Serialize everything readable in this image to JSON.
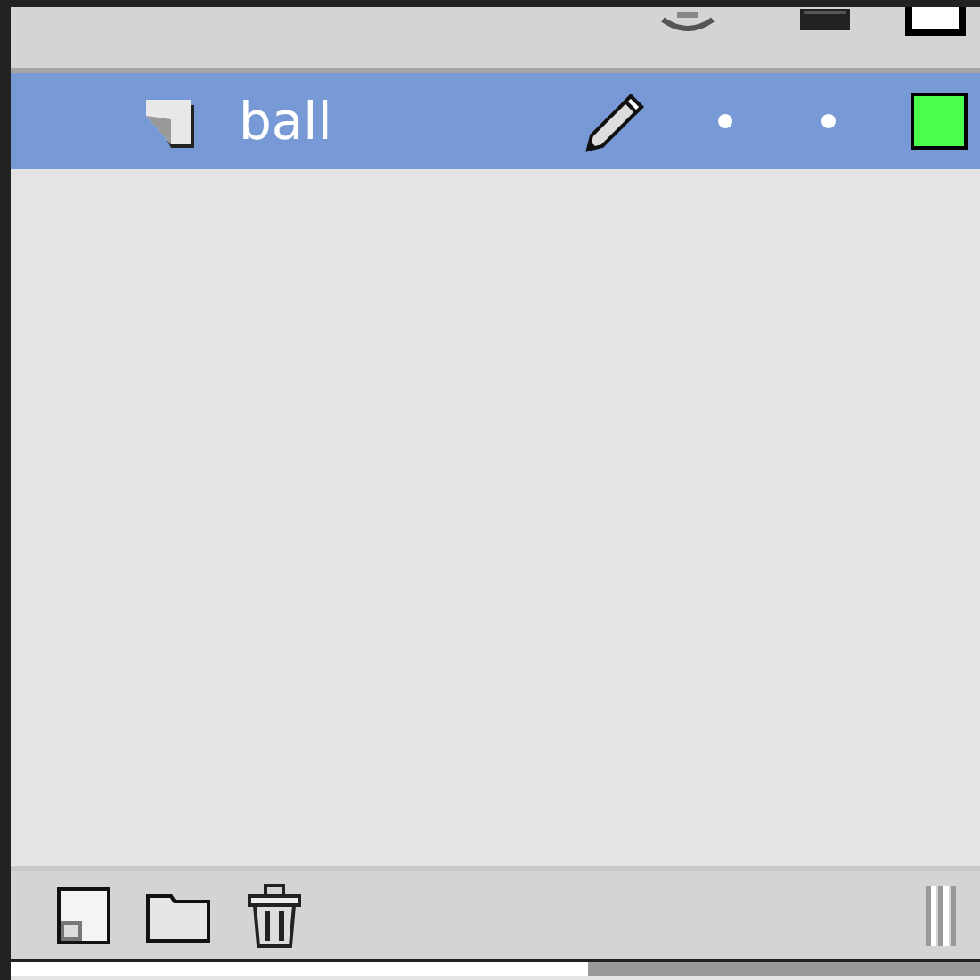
{
  "layers": [
    {
      "name": "ball",
      "selected": true,
      "editing": true,
      "hidden": false,
      "locked": false,
      "color": "#4dff4d"
    }
  ]
}
